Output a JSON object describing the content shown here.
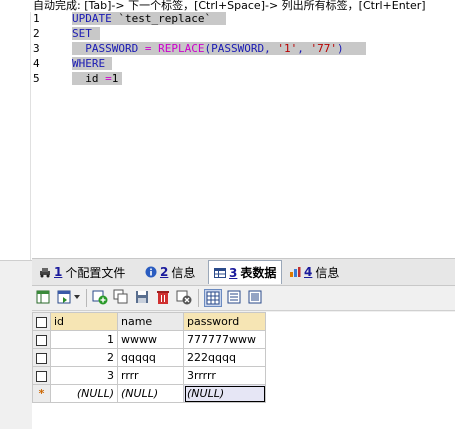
{
  "hint": "自动完成: [Tab]-> 下一个标签，[Ctrl+Space]-> 列出所有标签，[Ctrl+Enter]",
  "editor": {
    "line_numbers": [
      "1",
      "2",
      "3",
      "4",
      "5"
    ],
    "lines": [
      {
        "kw1": "UPDATE",
        "rest": " `test_replace`"
      },
      {
        "kw1": "SET"
      },
      {
        "ident": "PASSWORD",
        "eq": " = ",
        "fn": "REPLACE",
        "args_open": "(PASSWORD, ",
        "s1": "'1'",
        "comma": ", ",
        "s2": "'77'",
        "close": ")"
      },
      {
        "kw1": "WHERE"
      },
      {
        "ident": "id",
        "eq": " =",
        "val": "1"
      }
    ]
  },
  "tabs": [
    {
      "num": "1",
      "label": "个配置文件",
      "icon": "car-icon"
    },
    {
      "num": "2",
      "label": "信息",
      "icon": "info-icon"
    },
    {
      "num": "3",
      "label": "表数据",
      "icon": "table-icon",
      "active": true
    },
    {
      "num": "4",
      "label": "信息",
      "icon": "chart-icon"
    }
  ],
  "grid": {
    "columns": [
      "id",
      "name",
      "password"
    ],
    "rows": [
      {
        "id": "1",
        "name": "wwww",
        "password": "777777www"
      },
      {
        "id": "2",
        "name": "qqqqq",
        "password": "222qqqq"
      },
      {
        "id": "3",
        "name": "rrrr",
        "password": "3rrrrr"
      }
    ],
    "new_row": {
      "marker": "*",
      "id": "(NULL)",
      "name": "(NULL)",
      "password": "(NULL)"
    }
  }
}
